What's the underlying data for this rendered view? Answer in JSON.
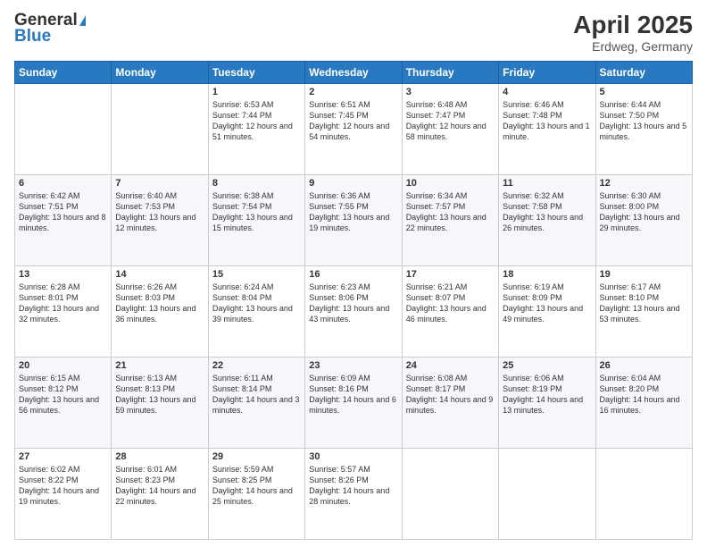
{
  "header": {
    "logo_general": "General",
    "logo_blue": "Blue",
    "month": "April 2025",
    "location": "Erdweg, Germany"
  },
  "weekdays": [
    "Sunday",
    "Monday",
    "Tuesday",
    "Wednesday",
    "Thursday",
    "Friday",
    "Saturday"
  ],
  "weeks": [
    [
      {
        "day": "",
        "info": ""
      },
      {
        "day": "",
        "info": ""
      },
      {
        "day": "1",
        "info": "Sunrise: 6:53 AM\nSunset: 7:44 PM\nDaylight: 12 hours and 51 minutes."
      },
      {
        "day": "2",
        "info": "Sunrise: 6:51 AM\nSunset: 7:45 PM\nDaylight: 12 hours and 54 minutes."
      },
      {
        "day": "3",
        "info": "Sunrise: 6:48 AM\nSunset: 7:47 PM\nDaylight: 12 hours and 58 minutes."
      },
      {
        "day": "4",
        "info": "Sunrise: 6:46 AM\nSunset: 7:48 PM\nDaylight: 13 hours and 1 minute."
      },
      {
        "day": "5",
        "info": "Sunrise: 6:44 AM\nSunset: 7:50 PM\nDaylight: 13 hours and 5 minutes."
      }
    ],
    [
      {
        "day": "6",
        "info": "Sunrise: 6:42 AM\nSunset: 7:51 PM\nDaylight: 13 hours and 8 minutes."
      },
      {
        "day": "7",
        "info": "Sunrise: 6:40 AM\nSunset: 7:53 PM\nDaylight: 13 hours and 12 minutes."
      },
      {
        "day": "8",
        "info": "Sunrise: 6:38 AM\nSunset: 7:54 PM\nDaylight: 13 hours and 15 minutes."
      },
      {
        "day": "9",
        "info": "Sunrise: 6:36 AM\nSunset: 7:55 PM\nDaylight: 13 hours and 19 minutes."
      },
      {
        "day": "10",
        "info": "Sunrise: 6:34 AM\nSunset: 7:57 PM\nDaylight: 13 hours and 22 minutes."
      },
      {
        "day": "11",
        "info": "Sunrise: 6:32 AM\nSunset: 7:58 PM\nDaylight: 13 hours and 26 minutes."
      },
      {
        "day": "12",
        "info": "Sunrise: 6:30 AM\nSunset: 8:00 PM\nDaylight: 13 hours and 29 minutes."
      }
    ],
    [
      {
        "day": "13",
        "info": "Sunrise: 6:28 AM\nSunset: 8:01 PM\nDaylight: 13 hours and 32 minutes."
      },
      {
        "day": "14",
        "info": "Sunrise: 6:26 AM\nSunset: 8:03 PM\nDaylight: 13 hours and 36 minutes."
      },
      {
        "day": "15",
        "info": "Sunrise: 6:24 AM\nSunset: 8:04 PM\nDaylight: 13 hours and 39 minutes."
      },
      {
        "day": "16",
        "info": "Sunrise: 6:23 AM\nSunset: 8:06 PM\nDaylight: 13 hours and 43 minutes."
      },
      {
        "day": "17",
        "info": "Sunrise: 6:21 AM\nSunset: 8:07 PM\nDaylight: 13 hours and 46 minutes."
      },
      {
        "day": "18",
        "info": "Sunrise: 6:19 AM\nSunset: 8:09 PM\nDaylight: 13 hours and 49 minutes."
      },
      {
        "day": "19",
        "info": "Sunrise: 6:17 AM\nSunset: 8:10 PM\nDaylight: 13 hours and 53 minutes."
      }
    ],
    [
      {
        "day": "20",
        "info": "Sunrise: 6:15 AM\nSunset: 8:12 PM\nDaylight: 13 hours and 56 minutes."
      },
      {
        "day": "21",
        "info": "Sunrise: 6:13 AM\nSunset: 8:13 PM\nDaylight: 13 hours and 59 minutes."
      },
      {
        "day": "22",
        "info": "Sunrise: 6:11 AM\nSunset: 8:14 PM\nDaylight: 14 hours and 3 minutes."
      },
      {
        "day": "23",
        "info": "Sunrise: 6:09 AM\nSunset: 8:16 PM\nDaylight: 14 hours and 6 minutes."
      },
      {
        "day": "24",
        "info": "Sunrise: 6:08 AM\nSunset: 8:17 PM\nDaylight: 14 hours and 9 minutes."
      },
      {
        "day": "25",
        "info": "Sunrise: 6:06 AM\nSunset: 8:19 PM\nDaylight: 14 hours and 13 minutes."
      },
      {
        "day": "26",
        "info": "Sunrise: 6:04 AM\nSunset: 8:20 PM\nDaylight: 14 hours and 16 minutes."
      }
    ],
    [
      {
        "day": "27",
        "info": "Sunrise: 6:02 AM\nSunset: 8:22 PM\nDaylight: 14 hours and 19 minutes."
      },
      {
        "day": "28",
        "info": "Sunrise: 6:01 AM\nSunset: 8:23 PM\nDaylight: 14 hours and 22 minutes."
      },
      {
        "day": "29",
        "info": "Sunrise: 5:59 AM\nSunset: 8:25 PM\nDaylight: 14 hours and 25 minutes."
      },
      {
        "day": "30",
        "info": "Sunrise: 5:57 AM\nSunset: 8:26 PM\nDaylight: 14 hours and 28 minutes."
      },
      {
        "day": "",
        "info": ""
      },
      {
        "day": "",
        "info": ""
      },
      {
        "day": "",
        "info": ""
      }
    ]
  ]
}
